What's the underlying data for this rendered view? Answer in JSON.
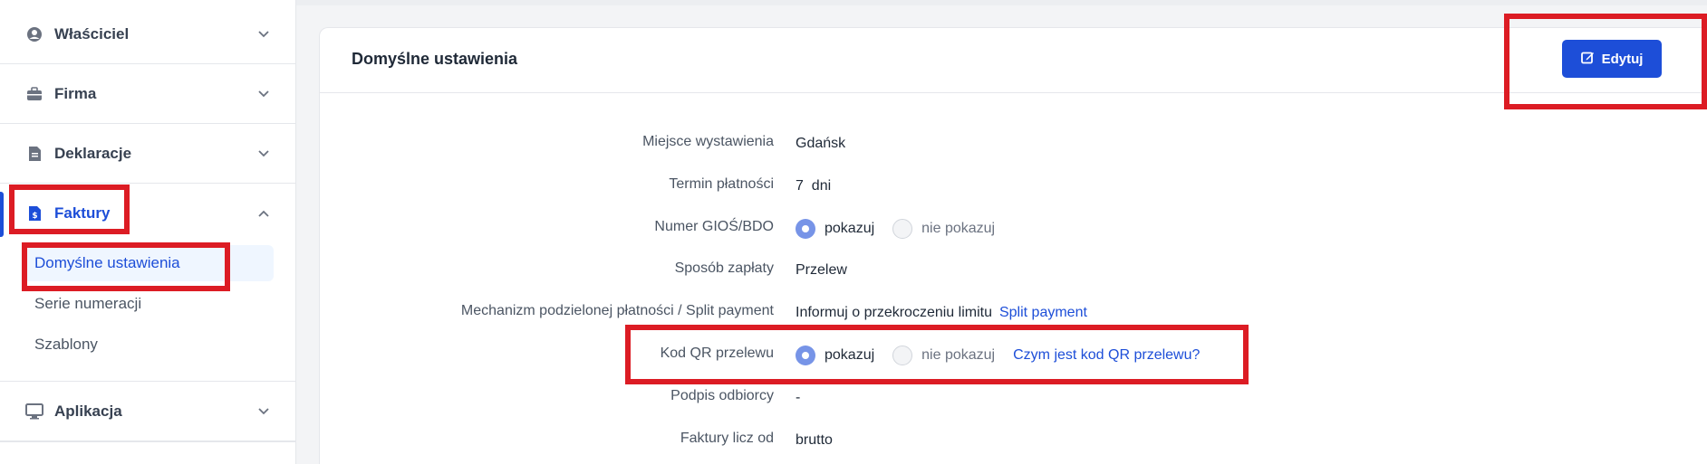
{
  "sidebar": {
    "items": [
      {
        "label": "Właściciel"
      },
      {
        "label": "Firma"
      },
      {
        "label": "Deklaracje"
      },
      {
        "label": "Faktury"
      },
      {
        "label": "Aplikacja"
      }
    ],
    "sub_items": [
      {
        "label": "Domyślne ustawienia"
      },
      {
        "label": "Serie numeracji"
      },
      {
        "label": "Szablony"
      }
    ]
  },
  "card": {
    "title": "Domyślne ustawienia",
    "edit_label": "Edytuj"
  },
  "rows": {
    "miejsce": {
      "label": "Miejsce wystawienia",
      "value": "Gdańsk"
    },
    "termin": {
      "label": "Termin płatności",
      "value": "7  dni"
    },
    "gios": {
      "label": "Numer GIOŚ/BDO",
      "opt_on": "pokazuj",
      "opt_off": "nie pokazuj"
    },
    "sposob": {
      "label": "Sposób zapłaty",
      "value": "Przelew"
    },
    "split": {
      "label": "Mechanizm podzielonej płatności / Split payment",
      "value": "Informuj o przekroczeniu limitu",
      "link": "Split payment"
    },
    "qr": {
      "label": "Kod QR przelewu",
      "opt_on": "pokazuj",
      "opt_off": "nie pokazuj",
      "link": "Czym jest kod QR przelewu?"
    },
    "podpis": {
      "label": "Podpis odbiorcy",
      "value": "-"
    },
    "licz": {
      "label": "Faktury licz od",
      "value": "brutto"
    }
  },
  "colors": {
    "accent": "#1d4ed8",
    "highlight": "#dc1c24"
  }
}
